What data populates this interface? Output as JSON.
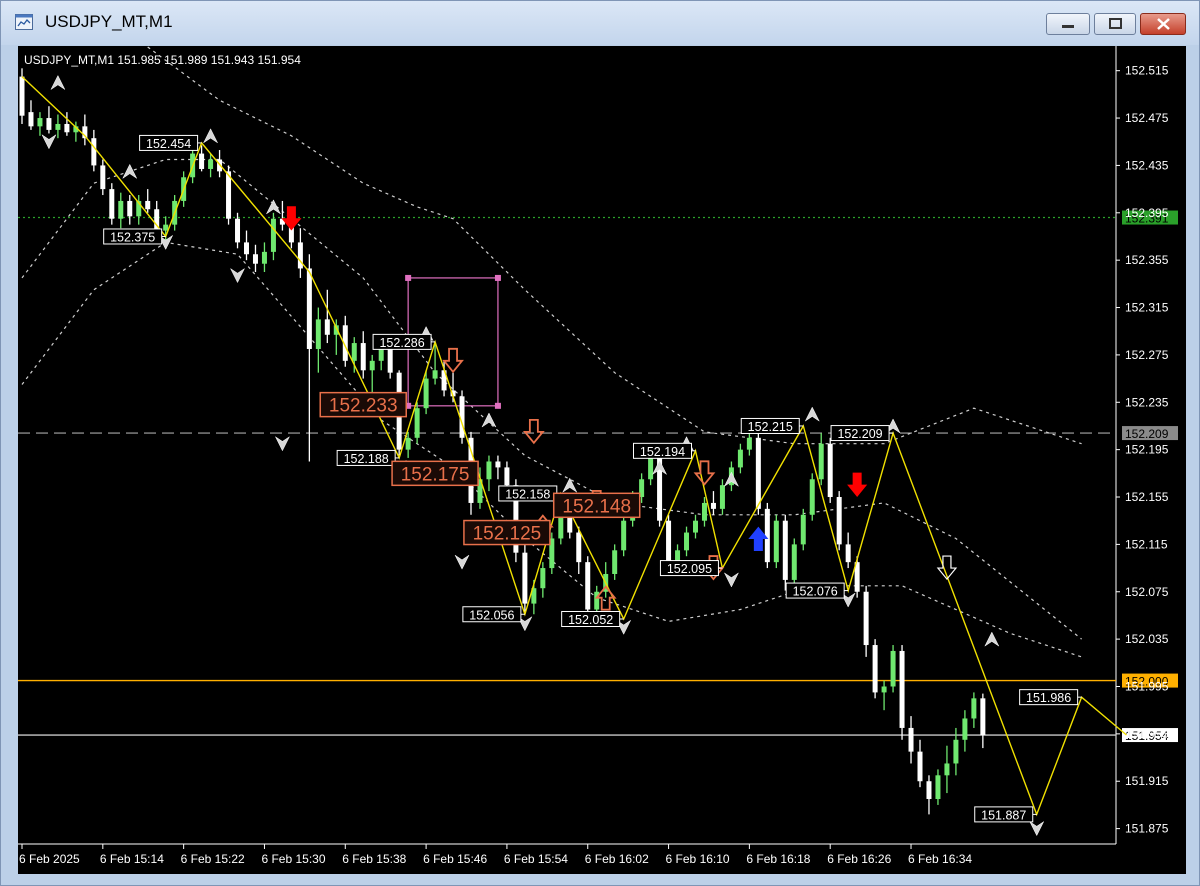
{
  "window": {
    "title": "USDJPY_MT,M1"
  },
  "chart_info": "USDJPY_MT,M1  151.985 151.989 151.943 151.954",
  "colors": {
    "background": "#000000",
    "bull": "#6fe86f",
    "bear": "#ffffff",
    "zigzag": "#f0e000",
    "bands": "#cfcfcf",
    "level_orange": "#ffb000",
    "level_green": "#2aa02a",
    "fib_box": "#e070c0",
    "big_label": "#e8704a",
    "arrow_red": "#ff0000",
    "arrow_blue": "#2040ff",
    "arrow_outline": "#e8704a"
  },
  "chart_data": {
    "type": "candlestick",
    "symbol": "USDJPY_MT",
    "timeframe": "M1",
    "ohlc_header": {
      "open": 151.985,
      "high": 151.989,
      "low": 151.943,
      "close": 151.954
    },
    "ylim": [
      151.862,
      152.535
    ],
    "y_ticks": [
      152.515,
      152.475,
      152.435,
      152.395,
      152.355,
      152.315,
      152.275,
      152.235,
      152.195,
      152.155,
      152.115,
      152.075,
      152.035,
      151.995,
      151.955,
      151.915,
      151.875
    ],
    "x_ticks": [
      {
        "index": 0,
        "label": "6 Feb 2025"
      },
      {
        "index": 9,
        "label": "6 Feb 15:14"
      },
      {
        "index": 18,
        "label": "6 Feb 15:22"
      },
      {
        "index": 27,
        "label": "6 Feb 15:30"
      },
      {
        "index": 36,
        "label": "6 Feb 15:38"
      },
      {
        "index": 45,
        "label": "6 Feb 15:46"
      },
      {
        "index": 54,
        "label": "6 Feb 15:54"
      },
      {
        "index": 63,
        "label": "6 Feb 16:02"
      },
      {
        "index": 72,
        "label": "6 Feb 16:10"
      },
      {
        "index": 81,
        "label": "6 Feb 16:18"
      },
      {
        "index": 90,
        "label": "6 Feb 16:26"
      },
      {
        "index": 99,
        "label": "6 Feb 16:34"
      }
    ],
    "bar_count": 108,
    "candles": [
      [
        152.51,
        152.517,
        152.47,
        152.477
      ],
      [
        152.48,
        152.49,
        152.465,
        152.468
      ],
      [
        152.468,
        152.48,
        152.46,
        152.475
      ],
      [
        152.475,
        152.485,
        152.462,
        152.465
      ],
      [
        152.465,
        152.478,
        152.458,
        152.47
      ],
      [
        152.47,
        152.48,
        152.46,
        152.463
      ],
      [
        152.463,
        152.472,
        152.455,
        152.468
      ],
      [
        152.468,
        152.478,
        152.452,
        152.458
      ],
      [
        152.458,
        152.465,
        152.43,
        152.435
      ],
      [
        152.435,
        152.44,
        152.41,
        152.415
      ],
      [
        152.415,
        152.42,
        152.385,
        152.39
      ],
      [
        152.39,
        152.412,
        152.382,
        152.405
      ],
      [
        152.405,
        152.41,
        152.385,
        152.392
      ],
      [
        152.392,
        152.41,
        152.385,
        152.405
      ],
      [
        152.405,
        152.415,
        152.395,
        152.398
      ],
      [
        152.398,
        152.405,
        152.375,
        152.38
      ],
      [
        152.38,
        152.392,
        152.372,
        152.385
      ],
      [
        152.385,
        152.41,
        152.38,
        152.405
      ],
      [
        152.405,
        152.43,
        152.4,
        152.425
      ],
      [
        152.425,
        152.454,
        152.42,
        152.445
      ],
      [
        152.445,
        152.452,
        152.43,
        152.432
      ],
      [
        152.432,
        152.445,
        152.425,
        152.44
      ],
      [
        152.44,
        152.448,
        152.425,
        152.43
      ],
      [
        152.43,
        152.435,
        152.385,
        152.39
      ],
      [
        152.39,
        152.395,
        152.365,
        152.37
      ],
      [
        152.37,
        152.38,
        152.355,
        152.36
      ],
      [
        152.36,
        152.368,
        152.345,
        152.352
      ],
      [
        152.352,
        152.37,
        152.345,
        152.362
      ],
      [
        152.362,
        152.395,
        152.355,
        152.39
      ],
      [
        152.39,
        152.405,
        152.38,
        152.385
      ],
      [
        152.385,
        152.395,
        152.365,
        152.37
      ],
      [
        152.37,
        152.382,
        152.34,
        152.348
      ],
      [
        152.348,
        152.36,
        152.185,
        152.28
      ],
      [
        152.28,
        152.315,
        152.26,
        152.305
      ],
      [
        152.305,
        152.33,
        152.285,
        152.292
      ],
      [
        152.292,
        152.305,
        152.275,
        152.3
      ],
      [
        152.3,
        152.308,
        152.265,
        152.27
      ],
      [
        152.27,
        152.29,
        152.26,
        152.285
      ],
      [
        152.285,
        152.295,
        152.255,
        152.262
      ],
      [
        152.262,
        152.275,
        152.24,
        152.27
      ],
      [
        152.27,
        152.29,
        152.262,
        152.285
      ],
      [
        152.285,
        152.292,
        152.255,
        152.26
      ],
      [
        152.26,
        152.262,
        152.19,
        152.195
      ],
      [
        152.195,
        152.21,
        152.188,
        152.205
      ],
      [
        152.205,
        152.235,
        152.2,
        152.23
      ],
      [
        152.23,
        152.262,
        152.225,
        152.255
      ],
      [
        152.255,
        152.286,
        152.25,
        152.262
      ],
      [
        152.262,
        152.27,
        152.24,
        152.245
      ],
      [
        152.245,
        152.26,
        152.235,
        152.24
      ],
      [
        152.24,
        152.245,
        152.2,
        152.205
      ],
      [
        152.205,
        152.21,
        152.14,
        152.15
      ],
      [
        152.15,
        152.18,
        152.145,
        152.17
      ],
      [
        152.17,
        152.19,
        152.16,
        152.185
      ],
      [
        152.185,
        152.19,
        152.17,
        152.18
      ],
      [
        152.18,
        152.185,
        152.16,
        152.165
      ],
      [
        152.165,
        152.17,
        152.1,
        152.108
      ],
      [
        152.108,
        152.115,
        152.056,
        152.065
      ],
      [
        152.065,
        152.085,
        152.056,
        152.078
      ],
      [
        152.078,
        152.1,
        152.07,
        152.095
      ],
      [
        152.095,
        152.125,
        152.09,
        152.12
      ],
      [
        152.12,
        152.158,
        152.115,
        152.15
      ],
      [
        152.15,
        152.155,
        152.12,
        152.125
      ],
      [
        152.125,
        152.13,
        152.09,
        152.1
      ],
      [
        152.1,
        152.105,
        152.052,
        152.06
      ],
      [
        152.06,
        152.08,
        152.055,
        152.075
      ],
      [
        152.075,
        152.1,
        152.07,
        152.09
      ],
      [
        152.09,
        152.115,
        152.085,
        152.11
      ],
      [
        152.11,
        152.14,
        152.105,
        152.135
      ],
      [
        152.135,
        152.16,
        152.13,
        152.155
      ],
      [
        152.155,
        152.175,
        152.15,
        152.17
      ],
      [
        152.17,
        152.194,
        152.165,
        152.188
      ],
      [
        152.188,
        152.192,
        152.13,
        152.135
      ],
      [
        152.135,
        152.14,
        152.095,
        152.1
      ],
      [
        152.1,
        152.115,
        152.095,
        152.11
      ],
      [
        152.11,
        152.13,
        152.105,
        152.125
      ],
      [
        152.125,
        152.14,
        152.12,
        152.135
      ],
      [
        152.135,
        152.155,
        152.13,
        152.15
      ],
      [
        152.15,
        152.16,
        152.14,
        152.145
      ],
      [
        152.145,
        152.17,
        152.14,
        152.165
      ],
      [
        152.165,
        152.185,
        152.16,
        152.18
      ],
      [
        152.18,
        152.2,
        152.175,
        152.195
      ],
      [
        152.195,
        152.215,
        152.19,
        152.205
      ],
      [
        152.205,
        152.21,
        152.14,
        152.145
      ],
      [
        152.145,
        152.15,
        152.095,
        152.1
      ],
      [
        152.1,
        152.14,
        152.095,
        152.135
      ],
      [
        152.135,
        152.14,
        152.076,
        152.085
      ],
      [
        152.085,
        152.12,
        152.08,
        152.115
      ],
      [
        152.115,
        152.145,
        152.11,
        152.14
      ],
      [
        152.14,
        152.175,
        152.135,
        152.17
      ],
      [
        152.17,
        152.209,
        152.165,
        152.2
      ],
      [
        152.2,
        152.205,
        152.15,
        152.155
      ],
      [
        152.155,
        152.16,
        152.11,
        152.115
      ],
      [
        152.115,
        152.125,
        152.095,
        152.1
      ],
      [
        152.1,
        152.105,
        152.07,
        152.075
      ],
      [
        152.075,
        152.08,
        152.02,
        152.03
      ],
      [
        152.03,
        152.035,
        151.985,
        151.99
      ],
      [
        151.99,
        152.0,
        151.975,
        151.995
      ],
      [
        151.995,
        152.03,
        151.99,
        152.025
      ],
      [
        152.025,
        152.03,
        151.95,
        151.96
      ],
      [
        151.96,
        151.97,
        151.93,
        151.94
      ],
      [
        151.94,
        151.95,
        151.91,
        151.915
      ],
      [
        151.915,
        151.92,
        151.887,
        151.9
      ],
      [
        151.9,
        151.925,
        151.895,
        151.92
      ],
      [
        151.92,
        151.945,
        151.905,
        151.93
      ],
      [
        151.93,
        151.96,
        151.92,
        151.95
      ],
      [
        151.95,
        151.975,
        151.94,
        151.968
      ],
      [
        151.968,
        151.99,
        151.96,
        151.985
      ],
      [
        151.985,
        151.989,
        151.943,
        151.954
      ]
    ],
    "zigzag": [
      [
        0,
        152.51
      ],
      [
        7,
        152.46
      ],
      [
        16,
        152.375
      ],
      [
        20,
        152.454
      ],
      [
        32,
        152.345
      ],
      [
        42,
        152.188
      ],
      [
        46,
        152.286
      ],
      [
        56,
        152.056
      ],
      [
        60,
        152.158
      ],
      [
        67,
        152.052
      ],
      [
        75,
        152.194
      ],
      [
        78,
        152.095
      ],
      [
        87,
        152.215
      ],
      [
        92,
        152.076
      ],
      [
        97,
        152.209
      ],
      [
        113,
        151.887
      ],
      [
        118,
        151.986
      ],
      [
        123,
        151.954
      ]
    ],
    "upper_band": [
      [
        0,
        152.34
      ],
      [
        8,
        152.42
      ],
      [
        16,
        152.44
      ],
      [
        22,
        152.44
      ],
      [
        30,
        152.39
      ],
      [
        38,
        152.34
      ],
      [
        46,
        152.26
      ],
      [
        56,
        152.19
      ],
      [
        66,
        152.15
      ],
      [
        76,
        152.14
      ],
      [
        86,
        152.14
      ],
      [
        96,
        152.15
      ],
      [
        104,
        152.12
      ],
      [
        118,
        152.035
      ]
    ],
    "outer_upper": [
      [
        14,
        152.535
      ],
      [
        22,
        152.49
      ],
      [
        30,
        152.46
      ],
      [
        38,
        152.42
      ],
      [
        44,
        152.4
      ],
      [
        48,
        152.39
      ],
      [
        56,
        152.33
      ],
      [
        66,
        152.26
      ],
      [
        76,
        152.21
      ],
      [
        86,
        152.2
      ],
      [
        96,
        152.2
      ],
      [
        106,
        152.23
      ],
      [
        118,
        152.2
      ]
    ],
    "lower_band": [
      [
        0,
        152.25
      ],
      [
        8,
        152.33
      ],
      [
        16,
        152.37
      ],
      [
        24,
        152.36
      ],
      [
        32,
        152.29
      ],
      [
        40,
        152.22
      ],
      [
        48,
        152.18
      ],
      [
        56,
        152.12
      ],
      [
        64,
        152.07
      ],
      [
        72,
        152.05
      ],
      [
        80,
        152.06
      ],
      [
        88,
        152.08
      ],
      [
        98,
        152.08
      ],
      [
        110,
        152.04
      ],
      [
        118,
        152.02
      ]
    ],
    "levels": [
      {
        "name": "green",
        "price": 152.391,
        "label": "152.391"
      },
      {
        "name": "gray-dashed",
        "price": 152.209,
        "label": "152.209"
      },
      {
        "name": "orange",
        "price": 152.0,
        "label": "152.000"
      },
      {
        "name": "current",
        "price": 151.954,
        "label": "151.954"
      }
    ],
    "swing_labels": [
      {
        "i": 20,
        "p": 152.454,
        "text": "152.454",
        "side": "left"
      },
      {
        "i": 16,
        "p": 152.375,
        "text": "152.375",
        "side": "left"
      },
      {
        "i": 46,
        "p": 152.286,
        "text": "152.286",
        "side": "left"
      },
      {
        "i": 42,
        "p": 152.188,
        "text": "152.188",
        "side": "left"
      },
      {
        "i": 60,
        "p": 152.158,
        "text": "152.158",
        "side": "left"
      },
      {
        "i": 56,
        "p": 152.056,
        "text": "152.056",
        "side": "left"
      },
      {
        "i": 67,
        "p": 152.052,
        "text": "152.052",
        "side": "left"
      },
      {
        "i": 75,
        "p": 152.194,
        "text": "152.194",
        "side": "left"
      },
      {
        "i": 78,
        "p": 152.095,
        "text": "152.095",
        "side": "left"
      },
      {
        "i": 87,
        "p": 152.215,
        "text": "152.215",
        "side": "left"
      },
      {
        "i": 97,
        "p": 152.209,
        "text": "152.209",
        "side": "left"
      },
      {
        "i": 92,
        "p": 152.076,
        "text": "152.076",
        "side": "left"
      },
      {
        "i": 118,
        "p": 151.986,
        "text": "151.986",
        "side": "left"
      },
      {
        "i": 113,
        "p": 151.887,
        "text": "151.887",
        "side": "left"
      }
    ],
    "big_labels": [
      {
        "i": 38,
        "p": 152.233,
        "text": "152.233"
      },
      {
        "i": 46,
        "p": 152.175,
        "text": "152.175"
      },
      {
        "i": 54,
        "p": 152.125,
        "text": "152.125"
      },
      {
        "i": 64,
        "p": 152.148,
        "text": "152.148"
      }
    ],
    "fib_box": {
      "i0": 43,
      "i1": 53,
      "p0": 152.34,
      "p1": 152.232
    },
    "signal_arrows": [
      {
        "i": 30,
        "p": 152.39,
        "dir": "down",
        "style": "solid-red"
      },
      {
        "i": 93,
        "p": 152.165,
        "dir": "down",
        "style": "solid-red"
      },
      {
        "i": 82,
        "p": 152.12,
        "dir": "up",
        "style": "solid-blue"
      },
      {
        "i": 48,
        "p": 152.27,
        "dir": "down",
        "style": "outline"
      },
      {
        "i": 57,
        "p": 152.21,
        "dir": "down",
        "style": "outline"
      },
      {
        "i": 58,
        "p": 152.13,
        "dir": "up",
        "style": "outline"
      },
      {
        "i": 64,
        "p": 152.15,
        "dir": "down",
        "style": "outline"
      },
      {
        "i": 65,
        "p": 152.07,
        "dir": "up",
        "style": "outline"
      },
      {
        "i": 76,
        "p": 152.175,
        "dir": "down",
        "style": "outline"
      },
      {
        "i": 77,
        "p": 152.095,
        "dir": "down",
        "style": "outline"
      },
      {
        "i": 103,
        "p": 152.095,
        "dir": "down",
        "style": "outline-white"
      }
    ],
    "fractals": [
      {
        "i": 4,
        "p": 152.505,
        "dir": "up"
      },
      {
        "i": 3,
        "p": 152.455,
        "dir": "down"
      },
      {
        "i": 12,
        "p": 152.43,
        "dir": "up"
      },
      {
        "i": 16,
        "p": 152.37,
        "dir": "down"
      },
      {
        "i": 21,
        "p": 152.46,
        "dir": "up"
      },
      {
        "i": 28,
        "p": 152.4,
        "dir": "up"
      },
      {
        "i": 24,
        "p": 152.342,
        "dir": "down"
      },
      {
        "i": 29,
        "p": 152.2,
        "dir": "down"
      },
      {
        "i": 45,
        "p": 152.293,
        "dir": "up"
      },
      {
        "i": 42,
        "p": 152.18,
        "dir": "down"
      },
      {
        "i": 52,
        "p": 152.22,
        "dir": "up"
      },
      {
        "i": 49,
        "p": 152.1,
        "dir": "down"
      },
      {
        "i": 56,
        "p": 152.048,
        "dir": "down"
      },
      {
        "i": 61,
        "p": 152.165,
        "dir": "up"
      },
      {
        "i": 67,
        "p": 152.045,
        "dir": "down"
      },
      {
        "i": 71,
        "p": 152.18,
        "dir": "up"
      },
      {
        "i": 74,
        "p": 152.2,
        "dir": "up"
      },
      {
        "i": 79,
        "p": 152.085,
        "dir": "down"
      },
      {
        "i": 79,
        "p": 152.17,
        "dir": "up"
      },
      {
        "i": 88,
        "p": 152.225,
        "dir": "up"
      },
      {
        "i": 92,
        "p": 152.068,
        "dir": "down"
      },
      {
        "i": 97,
        "p": 152.215,
        "dir": "up"
      },
      {
        "i": 108,
        "p": 152.035,
        "dir": "up"
      },
      {
        "i": 113,
        "p": 151.875,
        "dir": "down"
      }
    ]
  }
}
